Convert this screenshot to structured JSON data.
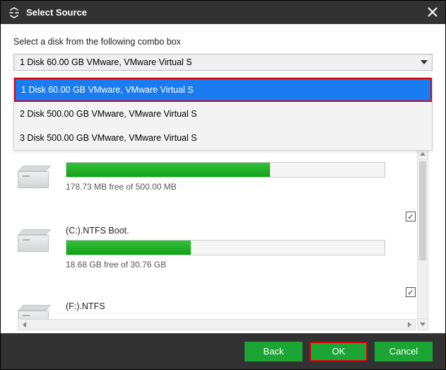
{
  "titlebar": {
    "title": "Select Source"
  },
  "instruction": "Select a disk from the following combo box",
  "combo": {
    "selected": "1 Disk 60.00 GB VMware,  VMware Virtual S"
  },
  "dropdown": {
    "options": [
      {
        "label": "1 Disk 60.00 GB VMware,  VMware Virtual S",
        "selected": true
      },
      {
        "label": "2 Disk 500.00 GB VMware,  VMware Virtual S",
        "selected": false
      },
      {
        "label": "3 Disk 500.00 GB VMware,  VMware Virtual S",
        "selected": false
      }
    ]
  },
  "partitions": [
    {
      "name": "",
      "free": "178.73 MB free of 500.00 MB",
      "fill_pct": 64,
      "checked": false,
      "show_check": false,
      "show_name": false
    },
    {
      "name": "(C:).NTFS Boot.",
      "free": "18.68 GB free of 30.76 GB",
      "fill_pct": 39,
      "checked": true,
      "show_check": true,
      "show_name": true
    },
    {
      "name": "(F:).NTFS",
      "free": "",
      "fill_pct": 0,
      "checked": true,
      "show_check": true,
      "show_name": true
    }
  ],
  "footer": {
    "back": "Back",
    "ok": "OK",
    "cancel": "Cancel"
  }
}
